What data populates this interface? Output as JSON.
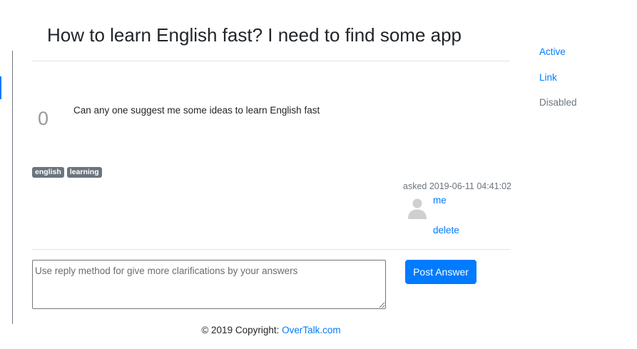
{
  "question": {
    "title": "How to learn English fast? I need to find some app",
    "votes": "0",
    "body": "Can any one suggest me some ideas to learn English fast",
    "tags": [
      "english",
      "learning"
    ],
    "asked": "asked 2019-06-11 04:41:02",
    "user": "me",
    "delete_label": "delete"
  },
  "reply": {
    "placeholder": "Use reply method for give more clarifications by your answers",
    "post_label": "Post Answer"
  },
  "footer": {
    "copyright": "© 2019 Copyright: ",
    "link_text": "OverTalk.com"
  },
  "side_nav": {
    "active": "Active",
    "link": "Link",
    "disabled": "Disabled"
  },
  "colors": {
    "primary": "#007bff",
    "tag_bg": "#6c757d",
    "muted": "#6c757d"
  },
  "icons": {
    "avatar": "user-avatar-icon"
  }
}
